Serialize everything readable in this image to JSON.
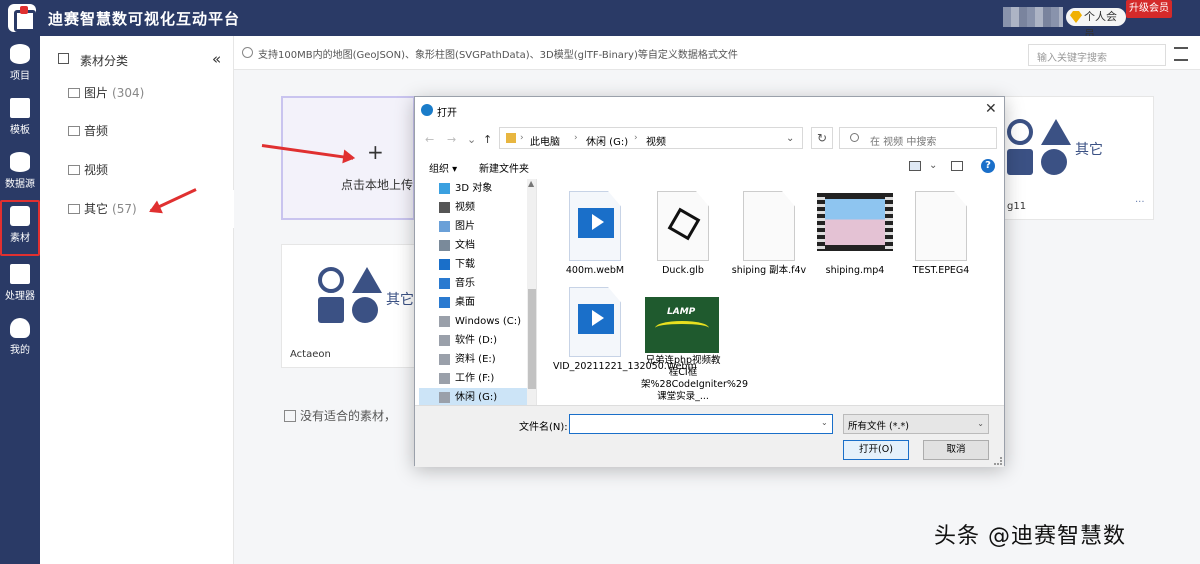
{
  "app": {
    "title": "迪赛智慧数可视化互动平台",
    "member_label": "个人会员",
    "upgrade_label": "升级会员"
  },
  "leftnav": {
    "items": [
      {
        "label": "项目",
        "icon": "layers-icon"
      },
      {
        "label": "模板",
        "icon": "template-icon"
      },
      {
        "label": "数据源",
        "icon": "database-icon"
      },
      {
        "label": "素材",
        "icon": "material-icon",
        "active": true
      },
      {
        "label": "处理器",
        "icon": "code-icon"
      },
      {
        "label": "我的",
        "icon": "user-icon"
      }
    ]
  },
  "category": {
    "heading": "素材分类",
    "collapse": "«",
    "items": [
      {
        "label": "图片",
        "count": "(304)"
      },
      {
        "label": "音频",
        "count": ""
      },
      {
        "label": "视频",
        "count": ""
      },
      {
        "label": "其它",
        "count": "(57)"
      }
    ]
  },
  "notice": {
    "text": "支持100MB内的地图(GeoJSON)、象形柱图(SVGPathData)、3D模型(glTF-Binary)等自定义数据格式文件",
    "search_placeholder": "输入关键字搜索"
  },
  "cards": {
    "upload_plus": "+",
    "upload_label": "点击本地上传",
    "other_label_1": "其它",
    "other_label_2": "其它",
    "card1_name": "g11",
    "card1_more": "···",
    "card2_name": "Actaeon",
    "no_fit": "没有适合的素材，"
  },
  "dialog": {
    "title": "打开",
    "close": "✕",
    "back": "←",
    "forward": "→",
    "dropdown": "⌄",
    "up": "↑",
    "breadcrumb": [
      "此电脑",
      "休闲 (G:)",
      "视频"
    ],
    "breadcrumb_sep": "›",
    "refresh": "↻",
    "search_placeholder": "在 视频 中搜索",
    "organize": "组织 ▾",
    "new_folder": "新建文件夹",
    "help": "?",
    "tree": [
      {
        "label": "3D 对象",
        "color": "#3aa0e0"
      },
      {
        "label": "视频",
        "color": "#555555"
      },
      {
        "label": "图片",
        "color": "#6aa0d8"
      },
      {
        "label": "文档",
        "color": "#7a8a9a"
      },
      {
        "label": "下载",
        "color": "#1a6fc9"
      },
      {
        "label": "音乐",
        "color": "#2a7ad0"
      },
      {
        "label": "桌面",
        "color": "#2a7ad0"
      },
      {
        "label": "Windows (C:)",
        "color": "#9aa0aa"
      },
      {
        "label": "软件 (D:)",
        "color": "#9aa0aa"
      },
      {
        "label": "资料 (E:)",
        "color": "#9aa0aa"
      },
      {
        "label": "工作 (F:)",
        "color": "#9aa0aa"
      },
      {
        "label": "休闲 (G:)",
        "color": "#9aa0aa",
        "selected": true
      }
    ],
    "files": [
      {
        "name": "400m.webM",
        "kind": "video-blue"
      },
      {
        "name": "Duck.glb",
        "kind": "glb"
      },
      {
        "name": "shiping 副本.f4v",
        "kind": "blank"
      },
      {
        "name": "shiping.mp4",
        "kind": "video-thumb"
      },
      {
        "name": "TEST.EPEG4",
        "kind": "blank"
      },
      {
        "name": "VID_20211221_132050.Webm",
        "kind": "video-blue"
      },
      {
        "name": "兄弟连php视频教程CI框架%28CodeIgniter%29课堂实录_...",
        "kind": "lamp"
      }
    ],
    "lamp_text": "LAMP",
    "filename_label": "文件名(N):",
    "filename_value": "",
    "filetype_value": "所有文件 (*.*)",
    "open_button": "打开(O)",
    "cancel_button": "取消"
  },
  "watermark": "头条 @迪赛智慧数",
  "colors": {
    "brand_navy": "#2a3a66",
    "accent_red": "#e03030",
    "win_blue": "#1a6fc9"
  }
}
